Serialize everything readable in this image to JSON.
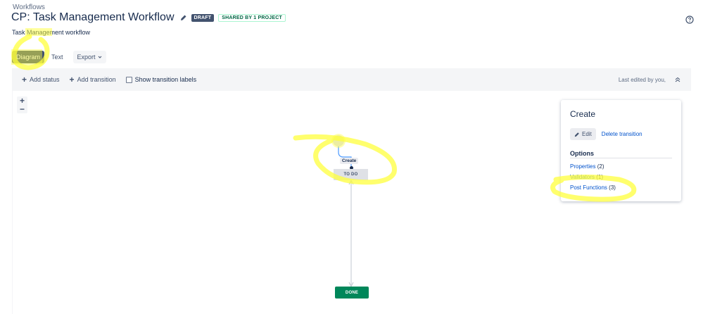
{
  "breadcrumb": "Workflows",
  "title": "CP: Task Management Workflow",
  "badges": {
    "draft": "DRAFT",
    "shared": "SHARED BY 1 PROJECT"
  },
  "description": "Task Management workflow",
  "view_tabs": {
    "diagram": "Diagram",
    "text": "Text",
    "export": "Export"
  },
  "toolbar": {
    "add_status": "Add status",
    "add_transition": "Add transition",
    "show_transition_labels": "Show transition labels",
    "last_edited": "Last edited by you,"
  },
  "zoom": {
    "in": "+",
    "out": "−"
  },
  "diagram": {
    "todo_status": "TO DO",
    "done_status": "DONE",
    "transition_label": "Create"
  },
  "panel": {
    "title": "Create",
    "edit_label": "Edit",
    "delete_transition": "Delete transition",
    "options_heading": "Options",
    "properties_label": "Properties",
    "properties_count": "(2)",
    "validators_label": "Validators",
    "validators_count": "(1)",
    "post_functions_label": "Post Functions",
    "post_functions_count": "(3)"
  },
  "colors": {
    "status_done": "#00875a",
    "status_todo": "#dfe1e6",
    "link": "#0052cc",
    "active_tab": "#42526e",
    "annotation_highlight": "#ffff3c"
  },
  "icons": [
    "pencil-icon",
    "help-icon",
    "chevron-down-icon",
    "plus-icon",
    "collapse-icon"
  ]
}
